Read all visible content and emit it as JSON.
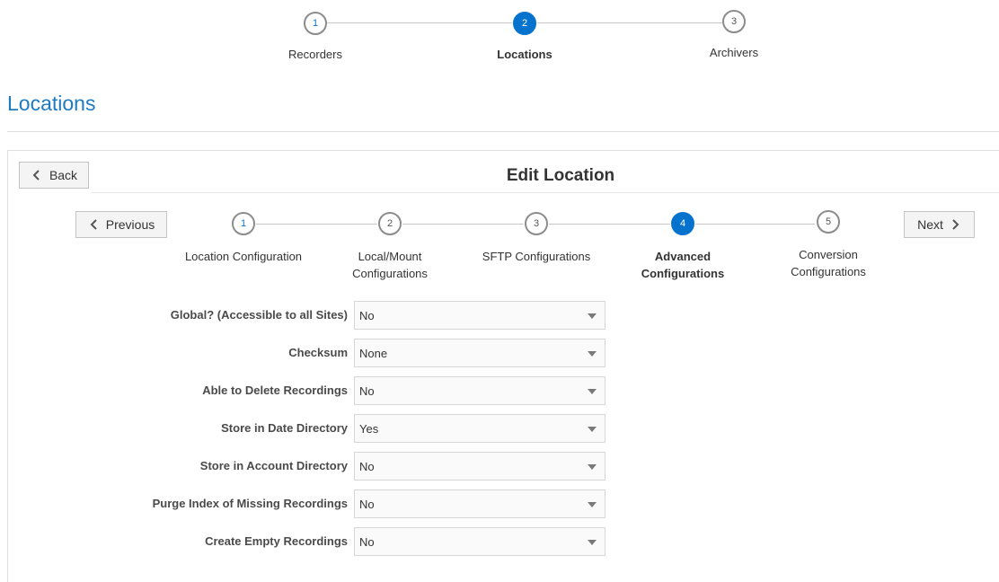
{
  "top_train": {
    "steps": [
      {
        "number": "1",
        "label": "Recorders"
      },
      {
        "number": "2",
        "label": "Locations"
      },
      {
        "number": "3",
        "label": "Archivers"
      }
    ]
  },
  "page": {
    "title": "Locations"
  },
  "panel": {
    "back_label": "Back",
    "title": "Edit Location",
    "previous_label": "Previous",
    "next_label": "Next",
    "steps": [
      {
        "number": "1",
        "label": "Location Configuration"
      },
      {
        "number": "2",
        "label": "Local/Mount Configurations"
      },
      {
        "number": "3",
        "label": "SFTP Configurations"
      },
      {
        "number": "4",
        "label": "Advanced Configurations"
      },
      {
        "number": "5",
        "label": "Conversion Configurations"
      }
    ]
  },
  "form": {
    "fields": [
      {
        "label": "Global? (Accessible to all Sites)",
        "value": "No"
      },
      {
        "label": "Checksum",
        "value": "None"
      },
      {
        "label": "Able to Delete Recordings",
        "value": "No"
      },
      {
        "label": "Store in Date Directory",
        "value": "Yes"
      },
      {
        "label": "Store in Account Directory",
        "value": "No"
      },
      {
        "label": "Purge Index of Missing Recordings",
        "value": "No"
      },
      {
        "label": "Create Empty Recordings",
        "value": "No"
      }
    ]
  },
  "colors": {
    "accent": "#0572ce",
    "title": "#1f7bbf"
  },
  "icons": {
    "back": "chevron-left-icon",
    "previous": "chevron-left-icon",
    "next": "chevron-right-icon",
    "dropdown": "caret-down-icon"
  }
}
